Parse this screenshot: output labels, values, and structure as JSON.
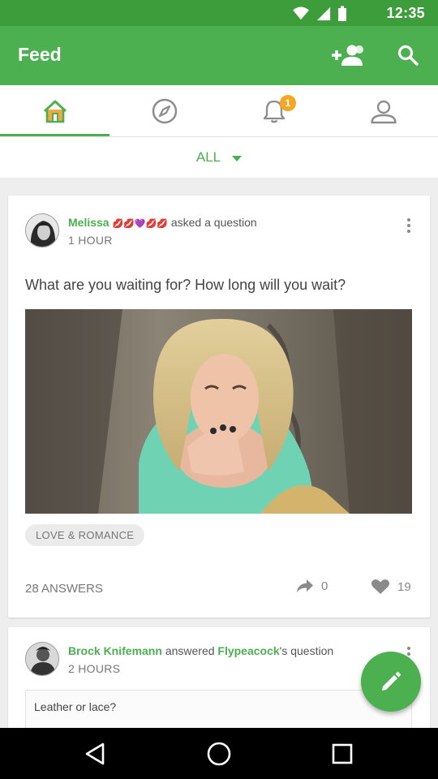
{
  "status_bar": {
    "time": "12:35"
  },
  "app_bar": {
    "title": "Feed",
    "actions": [
      {
        "icon": "add-friends-icon"
      },
      {
        "icon": "search-icon"
      }
    ]
  },
  "tabs": [
    {
      "icon": "home-icon",
      "active": true
    },
    {
      "icon": "compass-icon",
      "active": false
    },
    {
      "icon": "bell-icon",
      "active": false,
      "badge": "1"
    },
    {
      "icon": "profile-icon",
      "active": false
    }
  ],
  "filter": {
    "label": "ALL"
  },
  "feed": {
    "cards": [
      {
        "author": "Melissa",
        "emojis": "💋💋💜💋💋",
        "action": "asked a question",
        "time": "1 HOUR",
        "question": "What are you waiting for? How long will you wait?",
        "tag": "LOVE & ROMANCE",
        "answers": "28 ANSWERS",
        "shares": "0",
        "likes": "19"
      },
      {
        "author": "Brock Knifemann",
        "action": "answered",
        "target": "Flypeacock",
        "suffix": "'s question",
        "time": "2 HOURS",
        "question": "Leather or lace?"
      }
    ]
  },
  "colors": {
    "primary": "#4caf50",
    "status": "#3d9d3b",
    "badge": "#f5a623"
  }
}
